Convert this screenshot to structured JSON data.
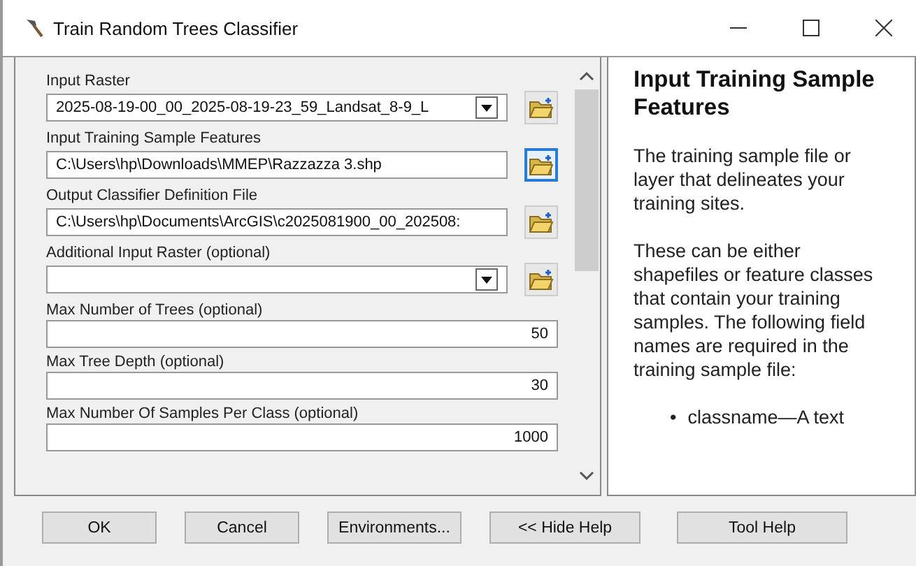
{
  "window": {
    "title": "Train Random Trees Classifier"
  },
  "parameters": [
    {
      "label": "Input Raster",
      "kind": "combo",
      "value": "2025-08-19-00_00_2025-08-19-23_59_Landsat_8-9_L",
      "selected": false
    },
    {
      "label": "Input Training Sample Features",
      "kind": "path",
      "value": "C:\\Users\\hp\\Downloads\\MMEP\\Razzazza 3.shp",
      "selected": true
    },
    {
      "label": "Output Classifier Definition File",
      "kind": "path",
      "value": "C:\\Users\\hp\\Documents\\ArcGIS\\c2025081900_00_202508:",
      "selected": false
    },
    {
      "label": "Additional Input Raster (optional)",
      "kind": "combo",
      "selected": false
    },
    {
      "label": "Max Number of Trees (optional)",
      "kind": "number",
      "value": "50",
      "selected": false
    },
    {
      "label": "Max Tree Depth (optional)",
      "kind": "number",
      "value": "30",
      "selected": false
    },
    {
      "label": "Max Number Of Samples Per Class (optional)",
      "kind": "number",
      "value": "1000",
      "selected": false
    }
  ],
  "help": {
    "title": "Input Training Sample Features",
    "paragraphs": [
      "The training sample file or layer that delineates your training sites.",
      "These can be either shapefiles or feature classes that contain your training samples. The following field names are required in the training sample file:"
    ],
    "bullets": [
      {
        "marker": "•",
        "text": "classname—A text"
      }
    ]
  },
  "buttons": [
    "OK",
    "Cancel",
    "Environments...",
    "<< Hide Help",
    "Tool Help"
  ]
}
